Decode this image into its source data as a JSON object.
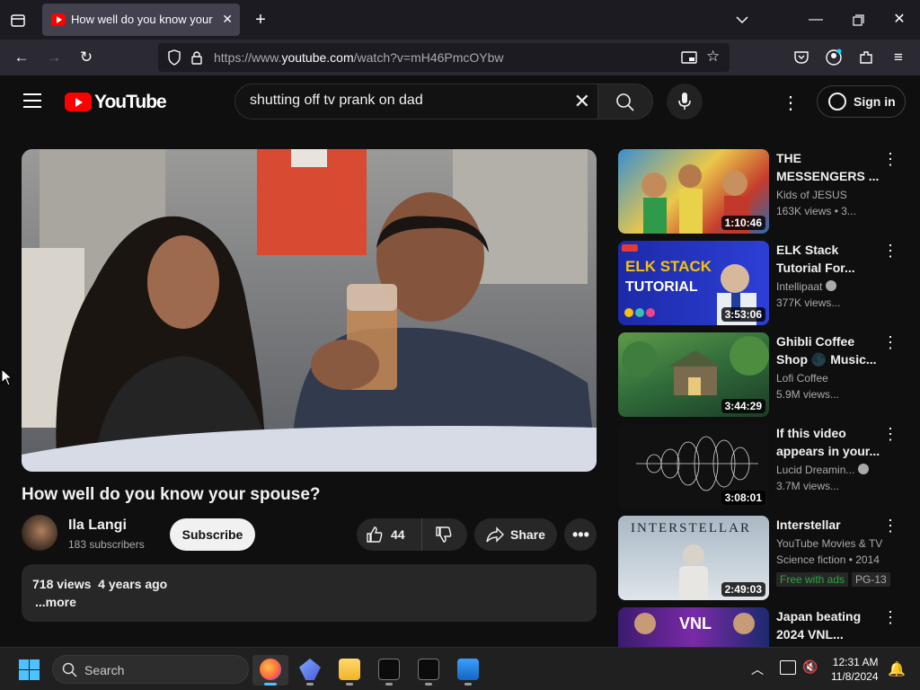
{
  "browser": {
    "tab_title": "How well do you know your spouse?",
    "url_prefix": "https://www.",
    "url_domain": "youtube.com",
    "url_path": "/watch?v=mH46PmcOYbw"
  },
  "youtube": {
    "logo_text": "YouTube",
    "search_value": "shutting off tv prank on dad",
    "signin_label": "Sign in"
  },
  "video": {
    "title": "How well do you know your spouse?",
    "channel": "Ila Langi",
    "subscribers": "183 subscribers",
    "subscribe_label": "Subscribe",
    "likes": "44",
    "share_label": "Share",
    "views": "718 views",
    "age": "4 years ago",
    "more_label": "...more"
  },
  "recommendations": [
    {
      "title": "THE MESSENGERS ...",
      "channel": "Kids of JESUS",
      "meta": "163K views  • 3...",
      "duration": "1:10:46",
      "verified": false
    },
    {
      "title": "ELK Stack Tutorial For...",
      "channel": "Intellipaat",
      "meta": "377K views...",
      "duration": "3:53:06",
      "verified": true
    },
    {
      "title": "Ghibli Coffee Shop 🌑 Music...",
      "channel": "Lofi Coffee",
      "meta": "5.9M views...",
      "duration": "3:44:29",
      "verified": false
    },
    {
      "title": "If this video appears in your...",
      "channel": "Lucid Dreamin...",
      "meta": "3.7M views...",
      "duration": "3:08:01",
      "verified": true
    },
    {
      "title": "Interstellar",
      "channel": "YouTube Movies & TV",
      "meta": "Science fiction • 2014",
      "badge1": "Free with ads",
      "badge2": "PG-13",
      "duration": "2:49:03",
      "verified": false
    },
    {
      "title": "Japan beating 2024 VNL...",
      "channel": "",
      "meta": "",
      "duration": "",
      "verified": false
    }
  ],
  "taskbar": {
    "search_label": "Search",
    "time": "12:31 AM",
    "date": "11/8/2024"
  },
  "colors": {
    "background": "#0f0f0f",
    "youtube_red": "#ff0000",
    "free_badge": "#2ba640"
  }
}
